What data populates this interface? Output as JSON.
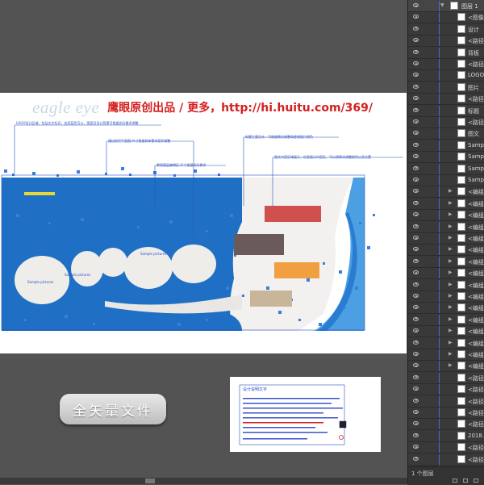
{
  "watermark": {
    "logo": "eagle eye",
    "text": "鹰眼原创出品 / 更多，http://hi.huitu.com/369/"
  },
  "annotations": [
    "LOGO设计区域，包括文字标识，加深蓝色可以，图案及设计背景可根据实际需求调整",
    "通过前页平面图:尺寸根据具体需求面积调整",
    "景观图层编辑区:尺寸根据实际需求",
    "标题主要设计，可根据情况调整和更改图片颜色",
    "图文内容区域展示，信息展示内容区，可以视情况调整颜色以及位置"
  ],
  "island_labels": [
    "Sample pictures",
    "Sample pictures",
    "Sample pictures"
  ],
  "side_panel_title": "设计说明文字",
  "full_vector_button": "全矢量文件",
  "layers_panel": {
    "top_layer": "图层 1",
    "rows": [
      "<图像>",
      "设计",
      "<路径>",
      "背板",
      "<路径>",
      "LOGO",
      "图片",
      "<路径>",
      "标题",
      "<路径>",
      "图文",
      "Samp",
      "Samp",
      "Samp",
      "Samp",
      "<编组>",
      "<编组>",
      "<编组>",
      "<编组>",
      "<编组>",
      "<编组>",
      "<编组>",
      "<编组>",
      "<编组>",
      "<编组>",
      "<编组>",
      "<编组>",
      "<编组>",
      "<编组>",
      "<编组>",
      "<编组>",
      "<路径>",
      "<路径>",
      "<路径>",
      "<路径>",
      "<路径>",
      "2018.",
      "<路径>",
      "<路径>"
    ],
    "footer_count": "1 个图层",
    "bottom_row": "绑学"
  },
  "colors": {
    "blue_main": "#1f6fc4",
    "blue_light": "#56a9e8",
    "bar_red": "#d05050",
    "bar_dark": "#6a5a5a",
    "bar_orange": "#f0a040",
    "bar_tan": "#c8b69a",
    "selection": "#2a4fbf"
  }
}
